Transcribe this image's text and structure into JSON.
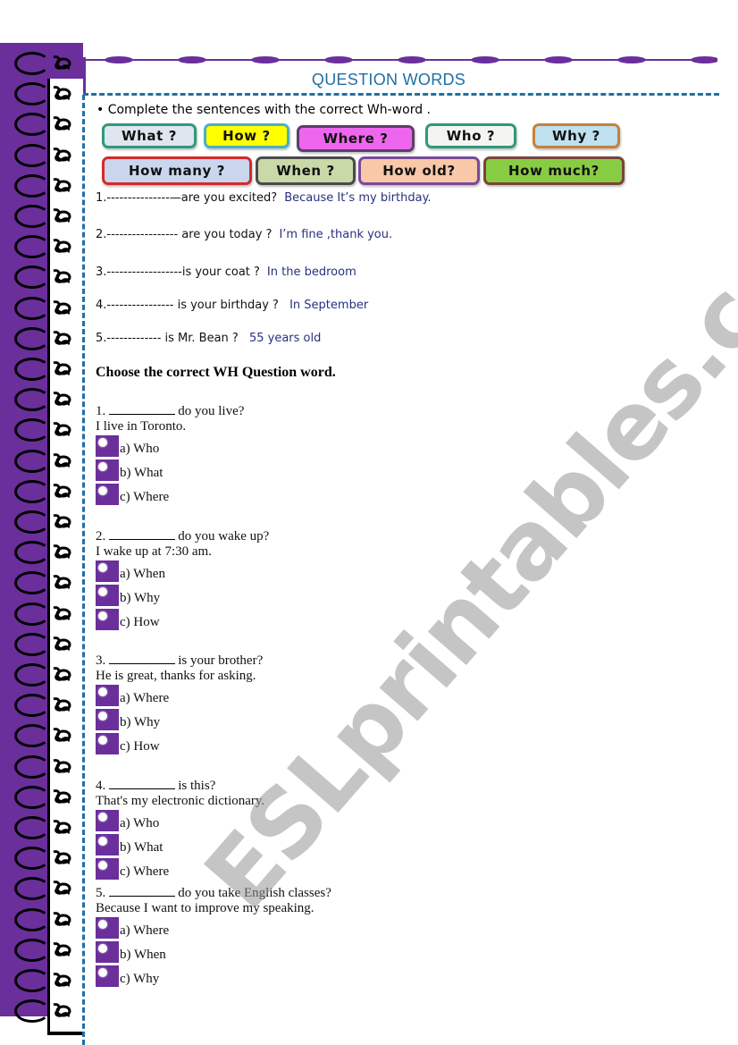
{
  "title": "QUESTION WORDS",
  "part1": {
    "instruction": "• Complete the sentences with the correct Wh-word .",
    "word_bank": [
      {
        "label": "What ?",
        "bg": "#dfe6ef",
        "border": "#2f9a7a"
      },
      {
        "label": "How ?",
        "bg": "#ffff00",
        "border": "#4ab0c8"
      },
      {
        "label": "Where ?",
        "bg": "#ee66ee",
        "border": "#5a3f6a"
      },
      {
        "label": "Who ?",
        "bg": "#f4f4f0",
        "border": "#2f9a7a"
      },
      {
        "label": "Why ?",
        "bg": "#bfe0ee",
        "border": "#c8803a"
      },
      {
        "label": "How many ?",
        "bg": "#c9d6ee",
        "border": "#d42a2a"
      },
      {
        "label": "When ?",
        "bg": "#c9d9a8",
        "border": "#4a4a4a"
      },
      {
        "label": "How old?",
        "bg": "#f8c8a8",
        "border": "#7a4a9a"
      },
      {
        "label": "How much?",
        "bg": "#88cc44",
        "border": "#7a4438"
      }
    ],
    "sentences": [
      {
        "prompt": "1.---------------—are you excited?",
        "answer": "Because It’s my birthday."
      },
      {
        "prompt": "2.----------------- are you today ?",
        "answer": "I’m fine ,thank you."
      },
      {
        "prompt": "3.------------------is  your coat ?",
        "answer": "In the bedroom"
      },
      {
        "prompt": "4.---------------- is your birthday ?",
        "answer": " In September"
      },
      {
        "prompt": "5.-------------  is Mr. Bean ?",
        "answer": "  55 years old"
      }
    ]
  },
  "part2": {
    "heading": "Choose the correct WH Question word.",
    "questions": [
      {
        "num": "1.",
        "after": "do you live?",
        "answer_line": "I live in Toronto.",
        "options": [
          "a) Who",
          "b) What",
          "c) Where"
        ]
      },
      {
        "num": "2.",
        "after": "do you wake up?",
        "answer_line": "I wake up at 7:30 am.",
        "options": [
          "a) When",
          "b) Why",
          "c) How"
        ]
      },
      {
        "num": "3.",
        "after": "is your brother?",
        "answer_line": "He is great, thanks for asking.",
        "options": [
          "a) Where",
          "b) Why",
          "c) How"
        ]
      },
      {
        "num": "4.",
        "after": "is this?",
        "answer_line": "That's my electronic dictionary.",
        "options": [
          "a) Who",
          "b) What",
          "c) Where"
        ]
      },
      {
        "num": "5.",
        "after": "do you take English classes?",
        "answer_line": "Because I want to improve my speaking.",
        "options": [
          "a) Where",
          "b) When",
          "c) Why"
        ]
      }
    ]
  },
  "watermark": "ESLprintables.com",
  "colors": {
    "accent_purple": "#6a2f9b",
    "dash_blue": "#1f6fa3",
    "answer_blue": "#27317f"
  }
}
